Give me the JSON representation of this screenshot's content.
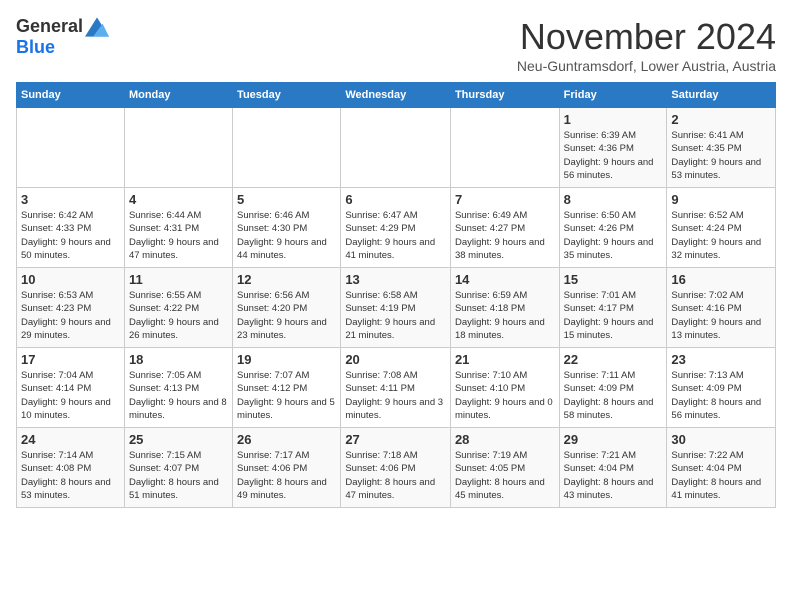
{
  "logo": {
    "general": "General",
    "blue": "Blue"
  },
  "title": {
    "month": "November 2024",
    "location": "Neu-Guntramsdorf, Lower Austria, Austria"
  },
  "days_of_week": [
    "Sunday",
    "Monday",
    "Tuesday",
    "Wednesday",
    "Thursday",
    "Friday",
    "Saturday"
  ],
  "weeks": [
    [
      {
        "day": "",
        "info": ""
      },
      {
        "day": "",
        "info": ""
      },
      {
        "day": "",
        "info": ""
      },
      {
        "day": "",
        "info": ""
      },
      {
        "day": "",
        "info": ""
      },
      {
        "day": "1",
        "info": "Sunrise: 6:39 AM\nSunset: 4:36 PM\nDaylight: 9 hours and 56 minutes."
      },
      {
        "day": "2",
        "info": "Sunrise: 6:41 AM\nSunset: 4:35 PM\nDaylight: 9 hours and 53 minutes."
      }
    ],
    [
      {
        "day": "3",
        "info": "Sunrise: 6:42 AM\nSunset: 4:33 PM\nDaylight: 9 hours and 50 minutes."
      },
      {
        "day": "4",
        "info": "Sunrise: 6:44 AM\nSunset: 4:31 PM\nDaylight: 9 hours and 47 minutes."
      },
      {
        "day": "5",
        "info": "Sunrise: 6:46 AM\nSunset: 4:30 PM\nDaylight: 9 hours and 44 minutes."
      },
      {
        "day": "6",
        "info": "Sunrise: 6:47 AM\nSunset: 4:29 PM\nDaylight: 9 hours and 41 minutes."
      },
      {
        "day": "7",
        "info": "Sunrise: 6:49 AM\nSunset: 4:27 PM\nDaylight: 9 hours and 38 minutes."
      },
      {
        "day": "8",
        "info": "Sunrise: 6:50 AM\nSunset: 4:26 PM\nDaylight: 9 hours and 35 minutes."
      },
      {
        "day": "9",
        "info": "Sunrise: 6:52 AM\nSunset: 4:24 PM\nDaylight: 9 hours and 32 minutes."
      }
    ],
    [
      {
        "day": "10",
        "info": "Sunrise: 6:53 AM\nSunset: 4:23 PM\nDaylight: 9 hours and 29 minutes."
      },
      {
        "day": "11",
        "info": "Sunrise: 6:55 AM\nSunset: 4:22 PM\nDaylight: 9 hours and 26 minutes."
      },
      {
        "day": "12",
        "info": "Sunrise: 6:56 AM\nSunset: 4:20 PM\nDaylight: 9 hours and 23 minutes."
      },
      {
        "day": "13",
        "info": "Sunrise: 6:58 AM\nSunset: 4:19 PM\nDaylight: 9 hours and 21 minutes."
      },
      {
        "day": "14",
        "info": "Sunrise: 6:59 AM\nSunset: 4:18 PM\nDaylight: 9 hours and 18 minutes."
      },
      {
        "day": "15",
        "info": "Sunrise: 7:01 AM\nSunset: 4:17 PM\nDaylight: 9 hours and 15 minutes."
      },
      {
        "day": "16",
        "info": "Sunrise: 7:02 AM\nSunset: 4:16 PM\nDaylight: 9 hours and 13 minutes."
      }
    ],
    [
      {
        "day": "17",
        "info": "Sunrise: 7:04 AM\nSunset: 4:14 PM\nDaylight: 9 hours and 10 minutes."
      },
      {
        "day": "18",
        "info": "Sunrise: 7:05 AM\nSunset: 4:13 PM\nDaylight: 9 hours and 8 minutes."
      },
      {
        "day": "19",
        "info": "Sunrise: 7:07 AM\nSunset: 4:12 PM\nDaylight: 9 hours and 5 minutes."
      },
      {
        "day": "20",
        "info": "Sunrise: 7:08 AM\nSunset: 4:11 PM\nDaylight: 9 hours and 3 minutes."
      },
      {
        "day": "21",
        "info": "Sunrise: 7:10 AM\nSunset: 4:10 PM\nDaylight: 9 hours and 0 minutes."
      },
      {
        "day": "22",
        "info": "Sunrise: 7:11 AM\nSunset: 4:09 PM\nDaylight: 8 hours and 58 minutes."
      },
      {
        "day": "23",
        "info": "Sunrise: 7:13 AM\nSunset: 4:09 PM\nDaylight: 8 hours and 56 minutes."
      }
    ],
    [
      {
        "day": "24",
        "info": "Sunrise: 7:14 AM\nSunset: 4:08 PM\nDaylight: 8 hours and 53 minutes."
      },
      {
        "day": "25",
        "info": "Sunrise: 7:15 AM\nSunset: 4:07 PM\nDaylight: 8 hours and 51 minutes."
      },
      {
        "day": "26",
        "info": "Sunrise: 7:17 AM\nSunset: 4:06 PM\nDaylight: 8 hours and 49 minutes."
      },
      {
        "day": "27",
        "info": "Sunrise: 7:18 AM\nSunset: 4:06 PM\nDaylight: 8 hours and 47 minutes."
      },
      {
        "day": "28",
        "info": "Sunrise: 7:19 AM\nSunset: 4:05 PM\nDaylight: 8 hours and 45 minutes."
      },
      {
        "day": "29",
        "info": "Sunrise: 7:21 AM\nSunset: 4:04 PM\nDaylight: 8 hours and 43 minutes."
      },
      {
        "day": "30",
        "info": "Sunrise: 7:22 AM\nSunset: 4:04 PM\nDaylight: 8 hours and 41 minutes."
      }
    ]
  ]
}
